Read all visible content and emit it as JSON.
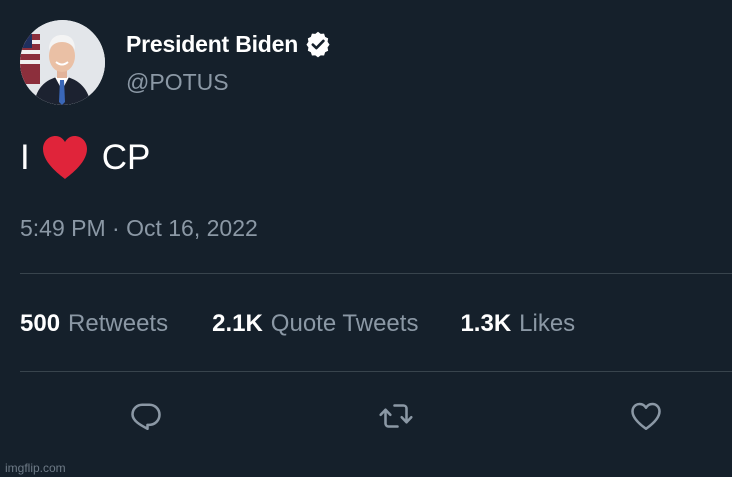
{
  "tweet": {
    "author": {
      "display_name": "President Biden",
      "handle": "@POTUS",
      "verified": true
    },
    "body": {
      "prefix": "I",
      "emoji": "red-heart",
      "suffix": "CP"
    },
    "timestamp": "5:49 PM · Oct 16, 2022",
    "stats": [
      {
        "value": "500",
        "label": "Retweets"
      },
      {
        "value": "2.1K",
        "label": "Quote Tweets"
      },
      {
        "value": "1.3K",
        "label": "Likes"
      }
    ],
    "actions": [
      "reply-icon",
      "retweet-icon",
      "like-icon"
    ]
  },
  "watermark": "imgflip.com",
  "colors": {
    "background": "#15202b",
    "text_primary": "#ffffff",
    "text_secondary": "#8b98a5",
    "divider": "#38444d",
    "heart": "#e0243a"
  }
}
